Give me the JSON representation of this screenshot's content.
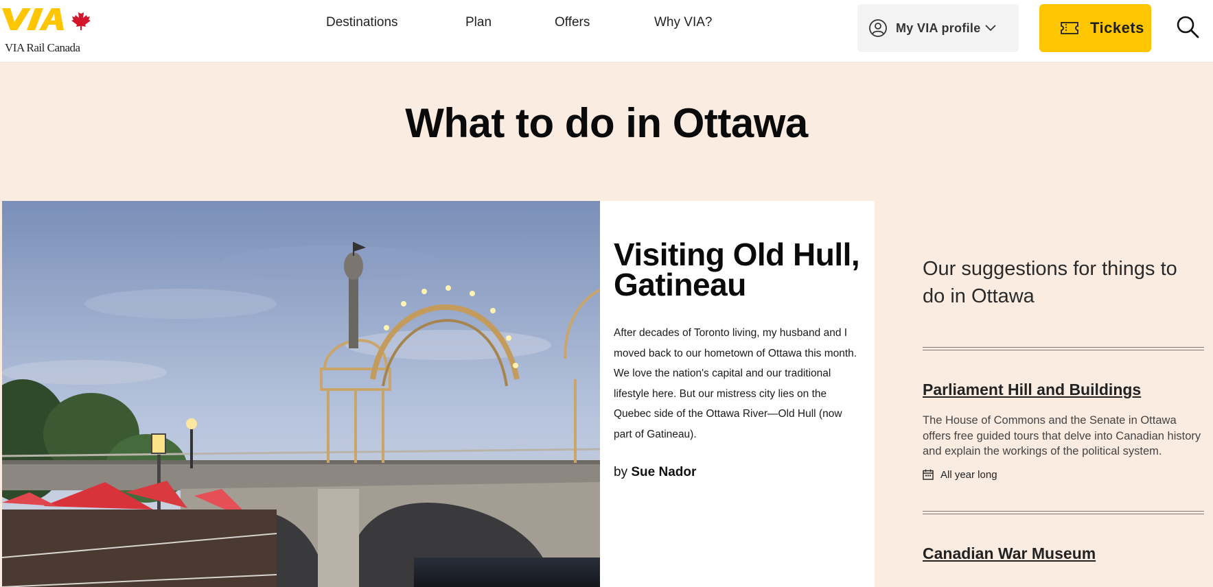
{
  "header": {
    "logo_text": "VIA Rail Canada",
    "nav": [
      "Destinations",
      "Plan",
      "Offers",
      "Why VIA?"
    ],
    "profile_label": "My VIA profile",
    "tickets_label": "Tickets"
  },
  "page": {
    "title": "What to do in Ottawa"
  },
  "feature": {
    "title": "Visiting Old Hull, Gatineau",
    "body": "After decades of Toronto living, my husband and I moved back to our hometown of Ottawa this month. We love the nation's capital and our traditional lifestyle here. But our mistress city lies on the Quebec side of the Ottawa River—Old Hull (now part of Gatineau).",
    "by_prefix": "by",
    "author": "Sue Nador"
  },
  "sidebar": {
    "heading": "Our suggestions for things to do in Ottawa",
    "items": [
      {
        "title": "Parliament Hill and Buildings",
        "description": "The House of Commons and the Senate in Ottawa offers free guided tours that delve into Canadian history and explain the workings of the political system.",
        "when": "All year long"
      },
      {
        "title": "Canadian War Museum"
      }
    ]
  },
  "colors": {
    "background": "#fbece1",
    "accent_yellow": "#fdc600",
    "maple_red": "#d3162b"
  }
}
